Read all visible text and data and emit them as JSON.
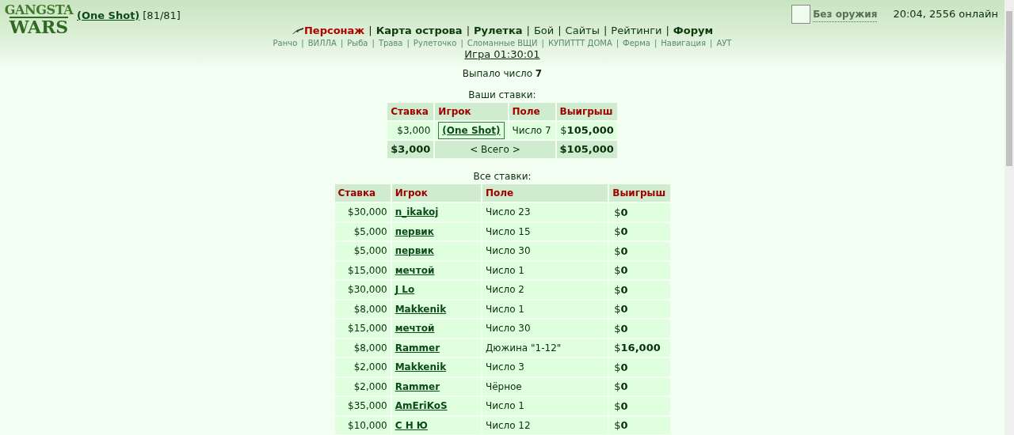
{
  "header": {
    "logo_top": "GANGSTA",
    "logo_bottom": "WARS",
    "player": "(One Shot)",
    "health": "[81/81]",
    "weapon": "Без оружия",
    "status": "20:04, 2556 онлайн"
  },
  "nav": {
    "separator": "|",
    "items": [
      {
        "label": "Персонаж",
        "kind": "active"
      },
      {
        "label": "Карта острова",
        "kind": "bold"
      },
      {
        "label": "Рулетка",
        "kind": "bold"
      },
      {
        "label": "Бой",
        "kind": "plain"
      },
      {
        "label": "Сайты",
        "kind": "plain"
      },
      {
        "label": "Рейтинги",
        "kind": "plain"
      },
      {
        "label": "Форум",
        "kind": "bold"
      }
    ]
  },
  "subnav": {
    "separator": "|",
    "items": [
      "Ранчо",
      "ВИЛЛА",
      "Рыба",
      "Трава",
      "Рулеточко",
      "Сломанные ВЩИ",
      "КУПИТТТ ДОМА",
      "Ферма",
      "Навигация",
      "АУТ"
    ]
  },
  "game_link": "Игра 01:30:01",
  "result": "Выпало число **7**",
  "my_bets": {
    "title": "Ваши ставки:",
    "columns": [
      "Ставка",
      "Игрок",
      "Поле",
      "Выигрыш"
    ],
    "rows": [
      {
        "stake": "$3,000",
        "player": "(One Shot)",
        "field": "Число 7",
        "win": "$**105,000**"
      }
    ],
    "total": {
      "stake": "$3,000",
      "label": "< Всего >",
      "win": "$105,000"
    }
  },
  "all_bets": {
    "title": "Все ставки:",
    "columns": [
      "Ставка",
      "Игрок",
      "Поле",
      "Выигрыш"
    ],
    "rows": [
      {
        "stake": "$30,000",
        "player": "n_ikakoj",
        "field": "Число 23",
        "win": "$**0**"
      },
      {
        "stake": "$5,000",
        "player": "первик",
        "field": "Число 15",
        "win": "$**0**"
      },
      {
        "stake": "$5,000",
        "player": "первик",
        "field": "Число 30",
        "win": "$**0**"
      },
      {
        "stake": "$15,000",
        "player": "мечтой",
        "field": "Число 1",
        "win": "$**0**"
      },
      {
        "stake": "$30,000",
        "player": "J Lo",
        "field": "Число 2",
        "win": "$**0**"
      },
      {
        "stake": "$8,000",
        "player": "Makkenik",
        "field": "Число 1",
        "win": "$**0**"
      },
      {
        "stake": "$15,000",
        "player": "мечтой",
        "field": "Число 30",
        "win": "$**0**"
      },
      {
        "stake": "$8,000",
        "player": "Rammer",
        "field": "Дюжина \"1-12\"",
        "win": "$**16,000**"
      },
      {
        "stake": "$2,000",
        "player": "Makkenik",
        "field": "Число 3",
        "win": "$**0**"
      },
      {
        "stake": "$2,000",
        "player": "Rammer",
        "field": "Чёрное",
        "win": "$**0**"
      },
      {
        "stake": "$35,000",
        "player": "AmEriKoS",
        "field": "Число 1",
        "win": "$**0**"
      },
      {
        "stake": "$10,000",
        "player": "С Н Ю",
        "field": "Число 12",
        "win": "$**0**"
      }
    ]
  }
}
